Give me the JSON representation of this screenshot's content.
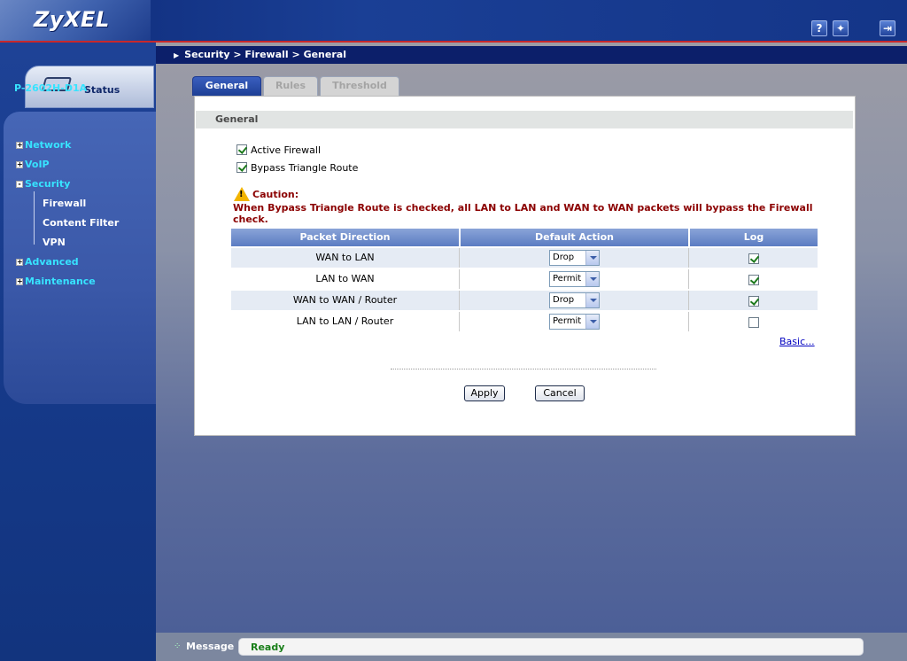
{
  "header": {
    "logo": "ZyXEL"
  },
  "sidebar": {
    "status_label": "Status",
    "device_name": "P-2602H-D1A",
    "items": [
      {
        "label": "Network",
        "expand": "+"
      },
      {
        "label": "VoIP",
        "expand": "+"
      },
      {
        "label": "Security",
        "expand": "-"
      },
      {
        "label": "Advanced",
        "expand": "+"
      },
      {
        "label": "Maintenance",
        "expand": "+"
      }
    ],
    "security_subitems": [
      "Firewall",
      "Content Filter",
      "VPN"
    ]
  },
  "breadcrumb": "Security > Firewall > General",
  "tabs": [
    "General",
    "Rules",
    "Threshold"
  ],
  "section_title": "General",
  "options": [
    {
      "label": "Active Firewall",
      "checked": true
    },
    {
      "label": "Bypass Triangle Route",
      "checked": true
    }
  ],
  "caution": {
    "title": "Caution:",
    "text": "When Bypass Triangle Route is checked, all LAN to LAN and WAN to WAN packets will bypass the Firewall check."
  },
  "table": {
    "headers": [
      "Packet Direction",
      "Default Action",
      "Log"
    ],
    "rows": [
      {
        "direction": "WAN to LAN",
        "action": "Drop",
        "log": true
      },
      {
        "direction": "LAN to WAN",
        "action": "Permit",
        "log": true
      },
      {
        "direction": "WAN to WAN / Router",
        "action": "Drop",
        "log": true
      },
      {
        "direction": "LAN to LAN / Router",
        "action": "Permit",
        "log": false
      }
    ]
  },
  "basic_link": "Basic...",
  "buttons": {
    "apply": "Apply",
    "cancel": "Cancel"
  },
  "statusbar": {
    "label": "Message",
    "value": "Ready"
  },
  "colors": {
    "accent": "#1e3f95",
    "caution": "#8b0000",
    "ready": "#1a7f1a"
  }
}
